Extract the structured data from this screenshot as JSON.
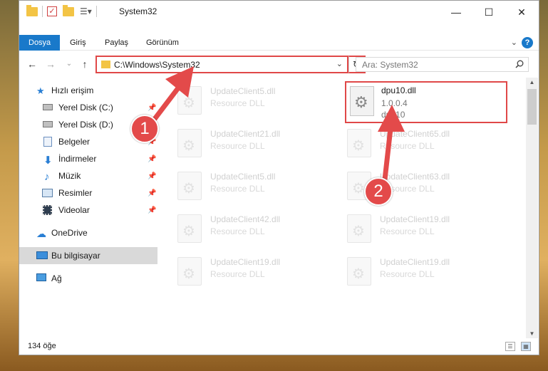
{
  "window": {
    "title": "System32"
  },
  "titlebar": {
    "minimize_glyph": "—",
    "maximize_glyph": "☐",
    "close_glyph": "✕"
  },
  "ribbon": {
    "tabs": [
      "Dosya",
      "Giriş",
      "Paylaş",
      "Görünüm"
    ],
    "active_tab": "Dosya",
    "help_glyph": "?"
  },
  "navigation": {
    "back_glyph": "←",
    "forward_glyph": "→",
    "recent_glyph": "⌄",
    "up_glyph": "↑"
  },
  "address": {
    "path": "C:\\Windows\\System32",
    "dropdown_glyph": "⌄",
    "refresh_glyph": "↻"
  },
  "search": {
    "placeholder": "Ara: System32",
    "icon": "search-icon"
  },
  "sidebar": {
    "items": [
      {
        "label": "Hızlı erişim",
        "icon": "star-icon",
        "pinned": false
      },
      {
        "label": "Yerel Disk (C:)",
        "icon": "drive-icon",
        "pinned": true
      },
      {
        "label": "Yerel Disk (D:)",
        "icon": "drive-icon",
        "pinned": true
      },
      {
        "label": "Belgeler",
        "icon": "documents-icon",
        "pinned": true
      },
      {
        "label": "İndirmeler",
        "icon": "downloads-icon",
        "pinned": true
      },
      {
        "label": "Müzik",
        "icon": "music-icon",
        "pinned": true
      },
      {
        "label": "Resimler",
        "icon": "pictures-icon",
        "pinned": true
      },
      {
        "label": "Videolar",
        "icon": "videos-icon",
        "pinned": true
      },
      {
        "label": "OneDrive",
        "icon": "cloud-icon",
        "pinned": false
      },
      {
        "label": "Bu bilgisayar",
        "icon": "computer-icon",
        "pinned": false,
        "selected": true
      },
      {
        "label": "Ağ",
        "icon": "network-icon",
        "pinned": false
      }
    ]
  },
  "files": {
    "left_column": [
      {
        "name": "UpdateClient5.dll",
        "desc": "Resource DLL"
      },
      {
        "name": "UpdateClient21.dll",
        "desc": "Resource DLL"
      },
      {
        "name": "UpdateClient5.dll",
        "desc": "Resource DLL"
      },
      {
        "name": "UpdateClient42.dll",
        "desc": "Resource DLL"
      },
      {
        "name": "UpdateClient19.dll",
        "desc": "Resource DLL"
      }
    ],
    "right_column": [
      {
        "name": "UpdateClient65.dll",
        "desc": "Resource DLL"
      },
      {
        "name": "UpdateClient63.dll",
        "desc": "Resource DLL"
      },
      {
        "name": "UpdateClient19.dll",
        "desc": "Resource DLL"
      },
      {
        "name": "UpdateClient19.dll",
        "desc": "Resource DLL"
      }
    ],
    "highlighted": {
      "name": "dpu10.dll",
      "version": "1.0.0.4",
      "subtitle": "dpu10"
    }
  },
  "status": {
    "item_count": "134 öğe"
  },
  "callouts": {
    "step1": "1",
    "step2": "2",
    "color": "#e34a4a"
  }
}
